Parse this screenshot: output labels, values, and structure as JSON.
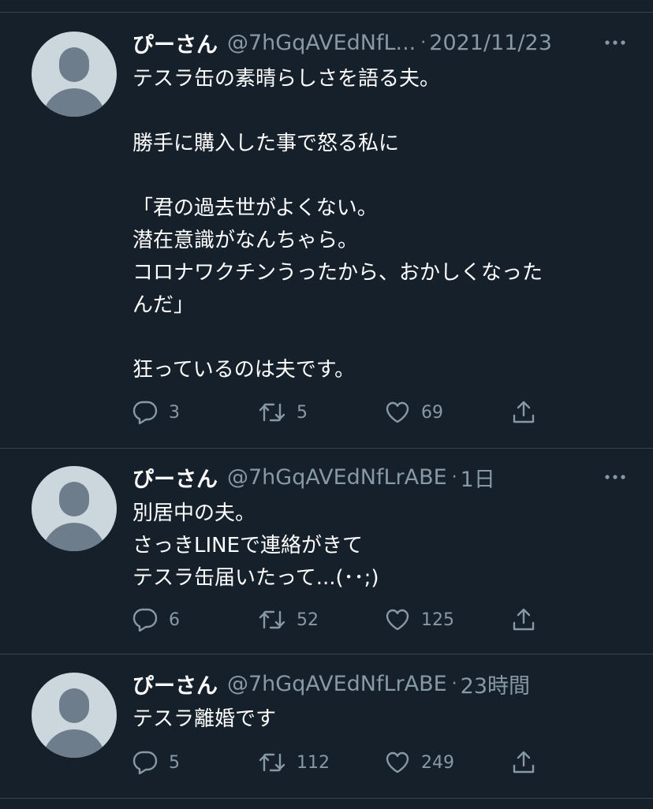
{
  "tweets": [
    {
      "name": "ぴーさん",
      "handle": "@7hGqAVEdNfL...",
      "separator": "·",
      "date": "2021/11/23",
      "lines": [
        "テスラ缶の素晴らしさを語る夫。",
        "",
        "勝手に購入した事で怒る私に",
        "",
        "「君の過去世がよくない。",
        "潜在意識がなんちゃら。",
        "コロナワクチンうったから、おかしくなった",
        "んだ」",
        "",
        "狂っているのは夫です。"
      ],
      "replies": "3",
      "retweets": "5",
      "likes": "69"
    },
    {
      "name": "ぴーさん",
      "handle": "@7hGqAVEdNfLrABE",
      "separator": "·",
      "date": "1日",
      "lines": [
        "別居中の夫。",
        "さっきLINEで連絡がきて",
        "テスラ缶届いたって...(･･;)"
      ],
      "replies": "6",
      "retweets": "52",
      "likes": "125"
    },
    {
      "name": "ぴーさん",
      "handle": "@7hGqAVEdNfLrABE",
      "separator": "·",
      "date": "23時間",
      "lines": [
        "テスラ離婚です"
      ],
      "replies": "5",
      "retweets": "112",
      "likes": "249"
    }
  ],
  "icons": {
    "reply": "speech-bubble",
    "retweet": "retweet-arrows",
    "like": "heart-outline",
    "share": "upload-arrow",
    "more": "horizontal-ellipsis"
  },
  "colors": {
    "background": "#15202b",
    "divider": "#38444d",
    "secondary_text": "#8899a6",
    "avatar_bg": "#ccd6dd",
    "avatar_fg": "#6e7d8b"
  }
}
